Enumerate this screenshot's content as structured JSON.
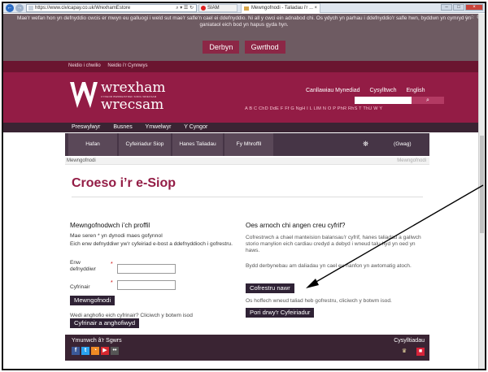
{
  "browser": {
    "url": "https://www.civicapay.co.uk/WrexhamEstore",
    "url_tools": "⌕ ▾ ☰ ↻",
    "tab_other": "SIAM",
    "tab_active": "Mewngofnodi - Taliadau i'r ...",
    "tab_close": "×",
    "nav_back": "←",
    "nav_forward": "→",
    "win_min": "–",
    "win_max": "□",
    "win_close": "×",
    "toolbar_icons": "⌂ ☆ ⚙"
  },
  "cookie": {
    "text": "Mae'r wefan hon yn defnyddio cwcis er mwyn eu galluogi i weld sut mae'r safle'n cael ei ddefnyddio. Ni all y cwci ein adnabod chi. Os ydych yn parhau i ddefnyddio'r safle hwn, byddwn yn cymryd yn ganiataol eich bod yn hapus gyda hyn.",
    "accept": "Derbyn",
    "reject": "Gwrthod"
  },
  "toplinks": [
    "Neidio i chwilio",
    "Neidio i'r Cynnwys"
  ],
  "logo": {
    "line1": "wrexham",
    "sub": "CYNGOR BWRDEISTREF SIROL WRECSAM",
    "line2": "wrecsam"
  },
  "header": {
    "links": [
      "Canllawiau Mynediad",
      "Cysylltwch",
      "English"
    ],
    "search_button": "⌕",
    "alphabet": "A B C ChD DdE F Ff G NgH I L LlM N O P PhR RhS T ThU W Y"
  },
  "mainnav": [
    "Preswylwyr",
    "Busnes",
    "Ymwelwyr",
    "Y Cyngor"
  ],
  "subnav": [
    "Hafan",
    "Cyfeiriadur Siop",
    "Hanes Taliadau",
    "Fy Mhroffil"
  ],
  "basket": {
    "icon": "⛯",
    "label": "(Gwag)"
  },
  "breadcrumb": {
    "current": "Mewngofnodi",
    "right": "Mewngofnodi"
  },
  "page": {
    "title": "Croeso i’r e-Siop"
  },
  "login": {
    "heading": "Mewngofnodwch i’ch proffil",
    "required": "Mae seren * yn dynodi maes gofynnol",
    "instructions": "Eich enw defnyddiwr yw'r cyfeiriad e-bost a ddefnyddioch i gofrestru.",
    "username_label_1": "Enw",
    "username_label_2": "defnyddiwr",
    "password_label": "Cyfrinair",
    "star": "*",
    "login_button": "Mewngofnodi",
    "forgot_text": "Wedi anghofio eich cyfrinair? Cliciwch y botwm isod",
    "forgot_button": "Cyfrinair a anghofiwyd"
  },
  "register": {
    "heading": "Oes arnoch chi angen creu cyfrif?",
    "p1": "Cofrestrwch a chael manteision balansau'r cyfrif, hanes taliadau a gallwch storio manylion eich cardiau credyd a debyd i wneud talu hyd yn oed yn haws.",
    "p2": "Bydd derbynebau am daliadau yn cael eu hanfon yn awtomatig atoch.",
    "register_button": "Cofrestru nawr",
    "guest_note": "Os hoffech wneud taliad heb gofrestru, cliciwch y botwm isod.",
    "guest_button": "Pori drwy'r Cyfeiriadur"
  },
  "footer": {
    "follow": "Ymunwch â'r Sgwrs",
    "social": [
      "f",
      "t",
      "◔",
      "▶",
      "••"
    ],
    "contact": "Cysylltiadau",
    "icons": [
      "♛",
      "■"
    ]
  }
}
